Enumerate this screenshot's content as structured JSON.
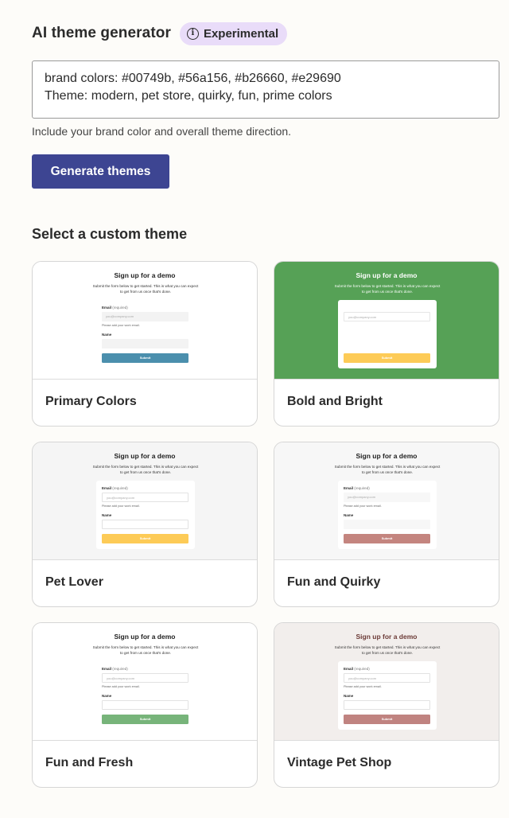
{
  "header": {
    "title": "AI theme generator",
    "badge": "Experimental",
    "badge_icon": "info-icon"
  },
  "prompt": {
    "value": "brand colors: #00749b, #56a156, #b26660, #e29690\nTheme: modern, pet store, quirky, fun, prime colors",
    "helper": "Include your brand color and overall theme direction."
  },
  "generate_button": "Generate themes",
  "section_title": "Select a custom theme",
  "preview_text": {
    "title": "Sign up for a demo",
    "subtitle": "Submit the form below to get started. This is what you can expect to get from us once that's done.",
    "email_label": "Email",
    "required": "(required)",
    "email_placeholder": "you@company.com",
    "email_hint": "Please add your work email.",
    "name_label": "Name",
    "submit": "Submit"
  },
  "themes": [
    {
      "name": "Primary Colors",
      "page_bg": "#ffffff",
      "form_bg": "#ffffff",
      "input_bg": "#f3f3f3",
      "button": "#4b8fad",
      "title_color": "#222222",
      "text_color": "#333333",
      "show_fields": true
    },
    {
      "name": "Bold and Bright",
      "page_bg": "#56a156",
      "form_bg": "#ffffff",
      "input_bg": "#ffffff",
      "button": "#fdcb57",
      "title_color": "#ffffff",
      "text_color": "#ffffff",
      "show_fields": false
    },
    {
      "name": "Pet Lover",
      "page_bg": "#f5f5f5",
      "form_bg": "#ffffff",
      "input_bg": "#ffffff",
      "button": "#fdcb57",
      "title_color": "#222222",
      "text_color": "#333333",
      "show_fields": true
    },
    {
      "name": "Fun and Quirky",
      "page_bg": "#f7f7f7",
      "form_bg": "#ffffff",
      "input_bg": "#f7f7f7",
      "button": "#c4857f",
      "title_color": "#222222",
      "text_color": "#333333",
      "show_fields": true
    },
    {
      "name": "Fun and Fresh",
      "page_bg": "#ffffff",
      "form_bg": "#ffffff",
      "input_bg": "#ffffff",
      "button": "#77b47a",
      "title_color": "#222222",
      "text_color": "#333333",
      "show_fields": true
    },
    {
      "name": "Vintage Pet Shop",
      "page_bg": "#f2eeec",
      "form_bg": "#ffffff",
      "input_bg": "#ffffff",
      "button": "#c08380",
      "title_color": "#6b3a36",
      "text_color": "#333333",
      "show_fields": true
    }
  ]
}
